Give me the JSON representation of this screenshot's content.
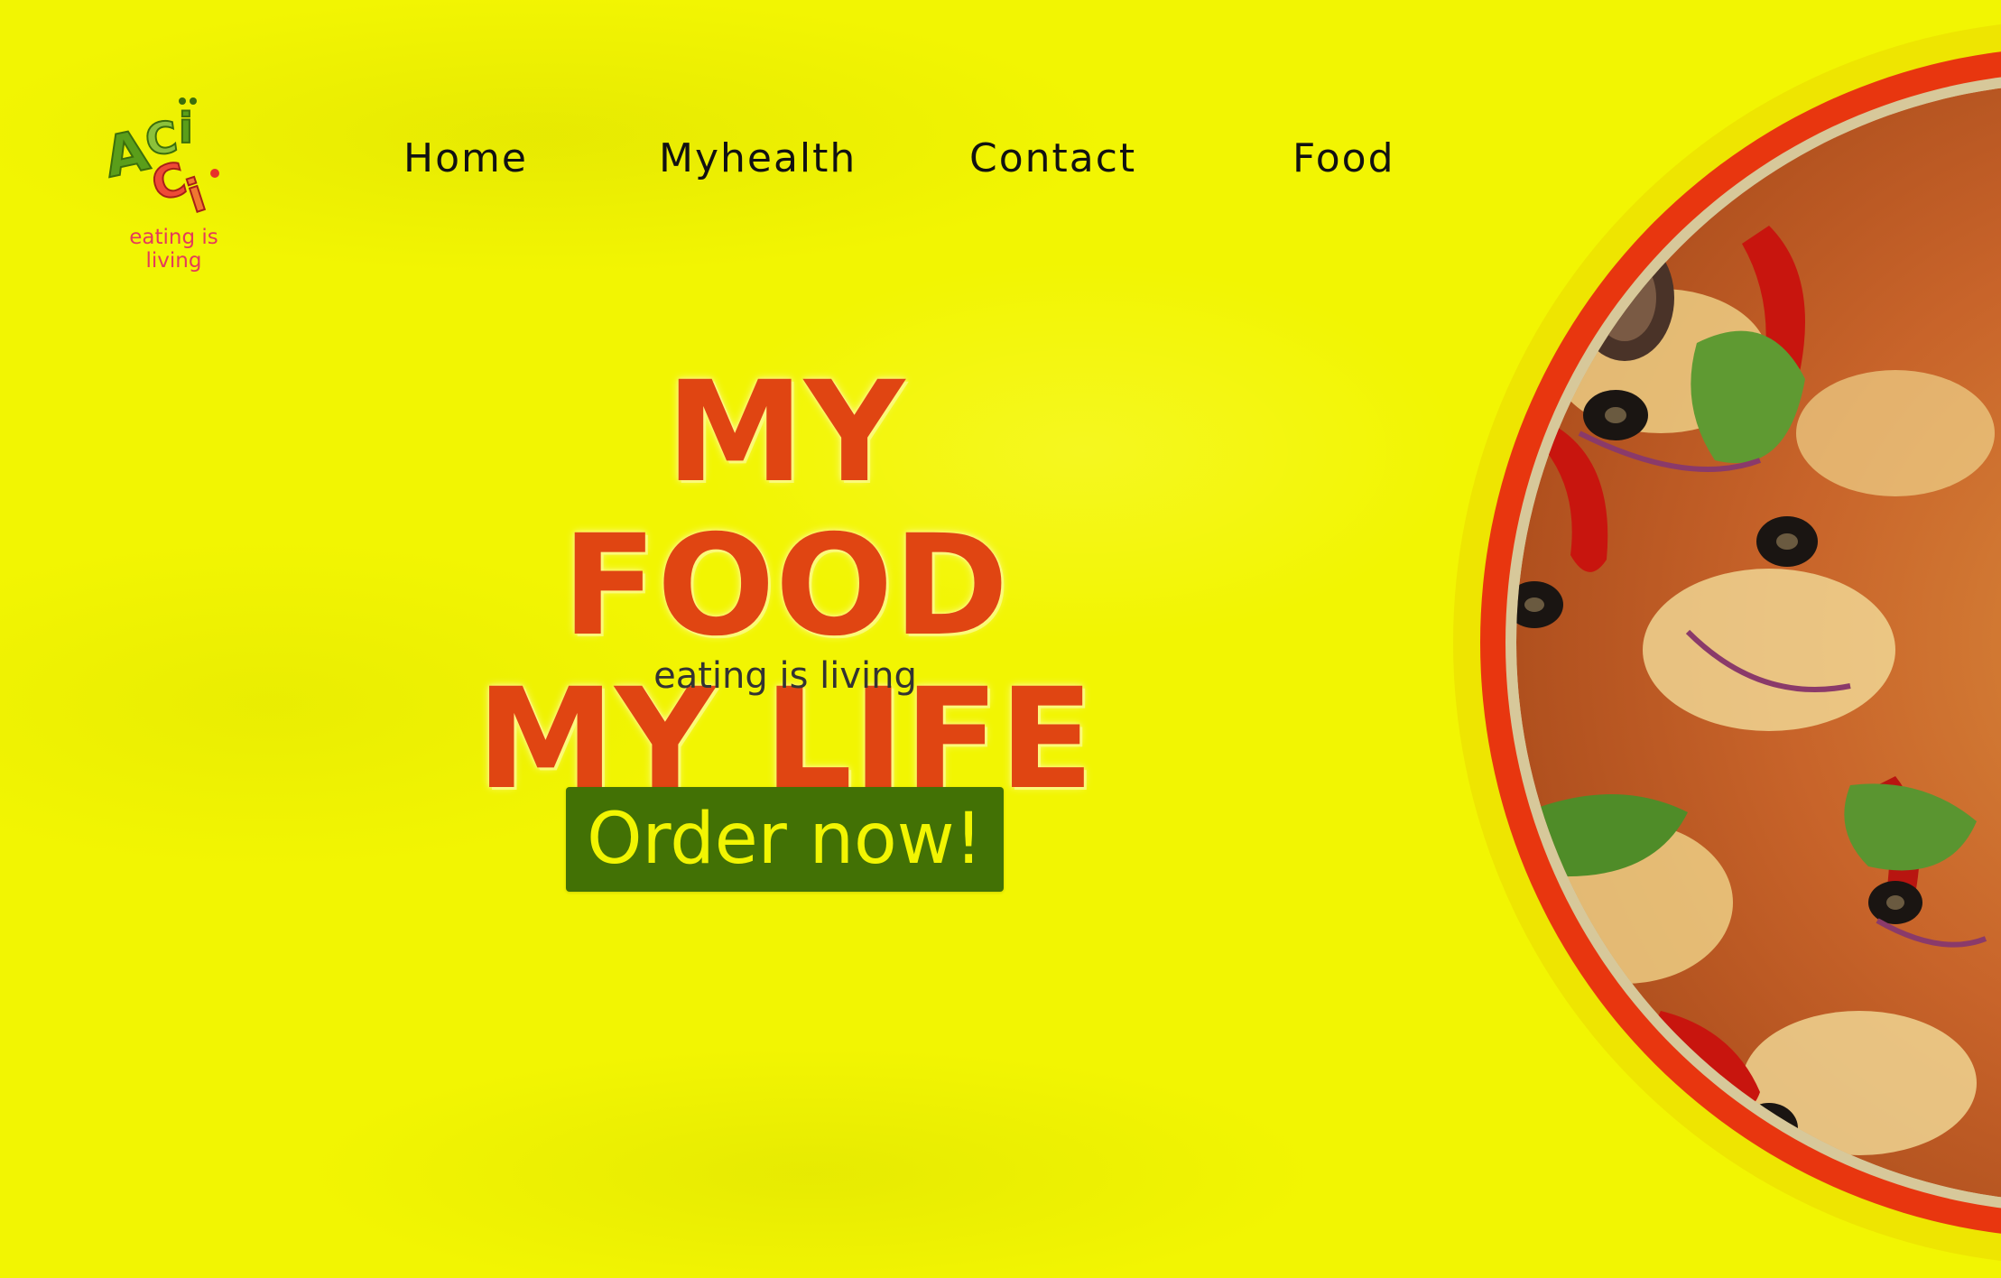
{
  "brand": {
    "logo_text": "eating is living",
    "logo_letters": "ACÏCI"
  },
  "nav": {
    "items": [
      {
        "label": "Home"
      },
      {
        "label": "Myhealth"
      },
      {
        "label": "Contact"
      },
      {
        "label": "Food"
      }
    ]
  },
  "hero": {
    "title_line1": "MY FOOD",
    "title_line2": "MY LIFE",
    "tagline": "eating is living",
    "cta": "Order now!"
  },
  "colors": {
    "background": "#f2f502",
    "title": "#e04512",
    "button": "#427105",
    "button_text": "#f2f502",
    "pizza_rim": "#e8360f"
  }
}
